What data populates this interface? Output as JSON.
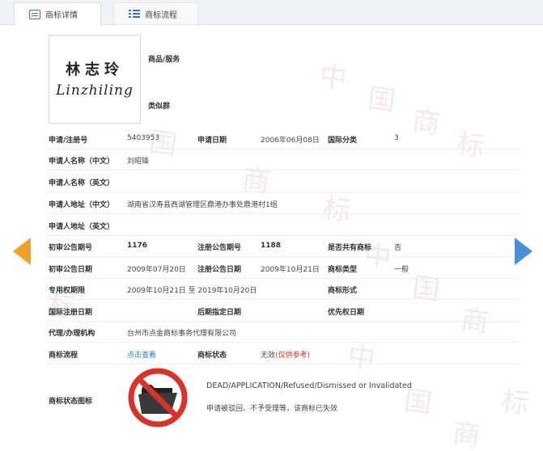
{
  "tabs": {
    "detail": "商标详情",
    "flow": "商标流程"
  },
  "watermark": [
    "中",
    "国",
    "商",
    "标",
    "中",
    "国",
    "商",
    "标",
    "中",
    "国",
    "商",
    "标",
    "中",
    "国",
    "商",
    "标"
  ],
  "logo": {
    "cn_text": "林志玲",
    "en_text": "Linzhiling"
  },
  "goods": {
    "goods_label": "商品/服务",
    "similar_label": "类似群"
  },
  "fields": {
    "reg_no_label": "申请/注册号",
    "reg_no": "5403953",
    "app_date_label": "申请日期",
    "app_date": "2006年06月08日",
    "intl_class_label": "国际分类",
    "intl_class": "3",
    "applicant_cn_label": "申请人名称（中文）",
    "applicant_cn": "刘昭锋",
    "applicant_en_label": "申请人名称（英文）",
    "address_cn_label": "申请人地址（中文）",
    "address_cn": "湖南省汉寿县西湖管理区鼎港办事处鼎港村1组",
    "address_en_label": "申请人地址（英文）",
    "prelim_issue_label": "初审公告期号",
    "prelim_issue": "1176",
    "reg_issue_label": "注册公告期号",
    "reg_issue": "1188",
    "shared_label": "是否共有商标",
    "shared": "否",
    "prelim_date_label": "初审公告日期",
    "prelim_date": "2009年07月20日",
    "reg_date_label": "注册公告日期",
    "reg_date": "2009年10月21日",
    "tm_type_label": "商标类型",
    "tm_type": "一般",
    "right_period_label": "专用权期限",
    "right_period": "2009年10月21日 至 2019年10月20日",
    "tm_form_label": "商标形式",
    "intl_reg_date_label": "国际注册日期",
    "later_date_label": "后期指定日期",
    "priority_date_label": "优先权日期",
    "agent_label": "代理/办理机构",
    "agent": "台州市点金商标事务代理有限公司",
    "flow_label": "商标流程",
    "flow_link": "点击查看",
    "status_label": "商标状态",
    "status_value": "无效",
    "status_note": "(仅供参考)",
    "status_icon_label": "商标状态图标",
    "status_en": "DEAD/APPLICATION/Refused/Dismissed or Invalidated",
    "status_cn": "申请被驳回、不予受理等，该商标已失效"
  },
  "colors": {
    "accent_blue": "#3b73b9",
    "link": "#2a7ab8",
    "status_red": "#d9372b",
    "arrow_left": "#f0a02a",
    "arrow_right": "#4b8fd6",
    "prohibition_red": "#d8322a"
  },
  "icons": {
    "prev": "arrow-left-icon",
    "next": "arrow-right-icon",
    "status": "prohibited-folder-icon"
  }
}
